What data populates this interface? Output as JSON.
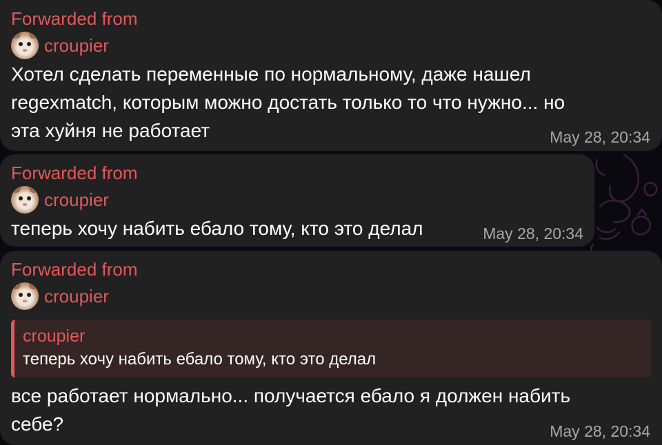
{
  "messages": [
    {
      "forward_label": "Forwarded from",
      "forward_user": "croupier",
      "text_lines": [
        "Хотел сделать переменные по нормальному, даже нашел",
        "regexmatch, которым можно достать только то что нужно... но",
        "эта хуйня не работает"
      ],
      "time": "May 28, 20:34"
    },
    {
      "forward_label": "Forwarded from",
      "forward_user": "croupier",
      "text_lines": [
        "теперь хочу набить ебало тому, кто это делал"
      ],
      "time": "May 28, 20:34"
    },
    {
      "forward_label": "Forwarded from",
      "forward_user": "croupier",
      "reply": {
        "author": "croupier",
        "text": "теперь хочу набить ебало тому, кто это делал"
      },
      "text_lines": [
        "все работает нормально... получается ебало я должен набить",
        "себе?"
      ],
      "time": "May 28, 20:34"
    }
  ],
  "colors": {
    "accent": "#e2585b",
    "bubble": "#212121",
    "background": "#0b0910",
    "quote_bg": "#352525",
    "time": "#a8a8ab"
  },
  "icons": {
    "avatar": "cat-avatar-photo"
  }
}
